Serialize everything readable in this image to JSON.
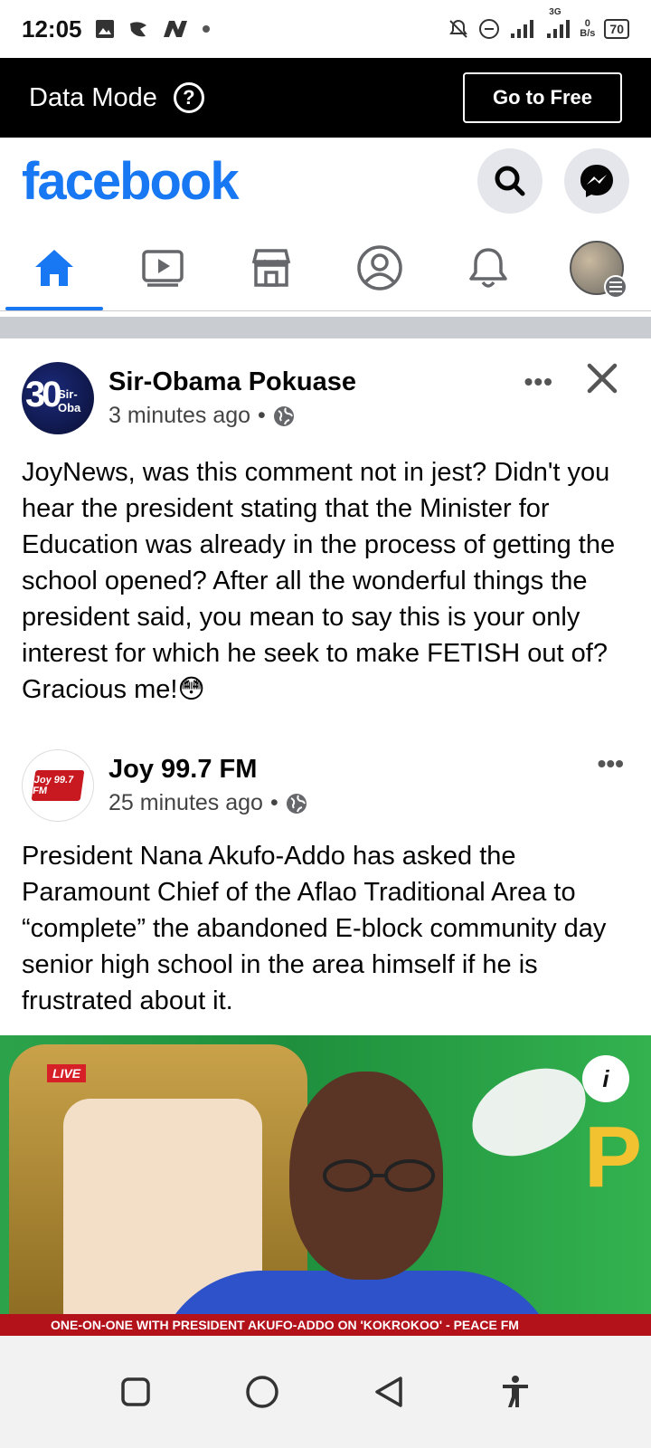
{
  "status_bar": {
    "time": "12:05",
    "network_speed_value": "0",
    "network_speed_unit": "B/s",
    "network_label": "3G",
    "battery": "70"
  },
  "data_mode": {
    "title": "Data Mode",
    "help_icon": "?",
    "go_free_label": "Go to Free"
  },
  "header": {
    "logo": "facebook",
    "search_icon": "search-icon",
    "messenger_icon": "messenger-icon"
  },
  "tabs": [
    {
      "name": "home",
      "icon": "home-icon",
      "active": true
    },
    {
      "name": "watch",
      "icon": "video-icon",
      "active": false
    },
    {
      "name": "marketplace",
      "icon": "store-icon",
      "active": false
    },
    {
      "name": "profile",
      "icon": "profile-icon",
      "active": false
    },
    {
      "name": "notifications",
      "icon": "bell-icon",
      "active": false
    },
    {
      "name": "menu",
      "icon": "avatar-menu-icon",
      "active": false
    }
  ],
  "post": {
    "author": "Sir-Obama Pokuase",
    "avatar_text": "Sir-Oba",
    "time": "3 minutes ago",
    "separator": "•",
    "audience_icon": "globe-icon",
    "text": "JoyNews, was this comment not in jest? Didn't you hear the president stating that the Minister for Education was already in the process of getting the school opened? After all the wonderful things the president said, you mean to say this is your only interest for which he seek to make FETISH out of? Gracious me!😳",
    "more_label": "•••",
    "close_label": "✕"
  },
  "shared_post": {
    "author": "Joy 99.7 FM",
    "avatar_text": "Joy 99.7 FM",
    "time": "25 minutes ago",
    "separator": "•",
    "audience_icon": "globe-icon",
    "more_label": "•••",
    "text": "President Nana Akufo-Addo has asked the Paramount Chief of the Aflao Traditional Area to “complete” the abandoned E-block community day senior high school in the area himself if he is frustrated about it."
  },
  "news_image": {
    "live_label": "LIVE",
    "info_label": "i",
    "ticker_text": "ONE-ON-ONE WITH PRESIDENT AKUFO-ADDO ON 'KOKROKOO' - PEACE FM"
  },
  "nav_bar": {
    "recents_icon": "square-icon",
    "home_icon": "circle-icon",
    "back_icon": "back-triangle-icon",
    "accessibility_icon": "accessibility-icon"
  },
  "colors": {
    "brand": "#1877f2",
    "data_bar": "#000000",
    "ticker": "#b3121b"
  }
}
